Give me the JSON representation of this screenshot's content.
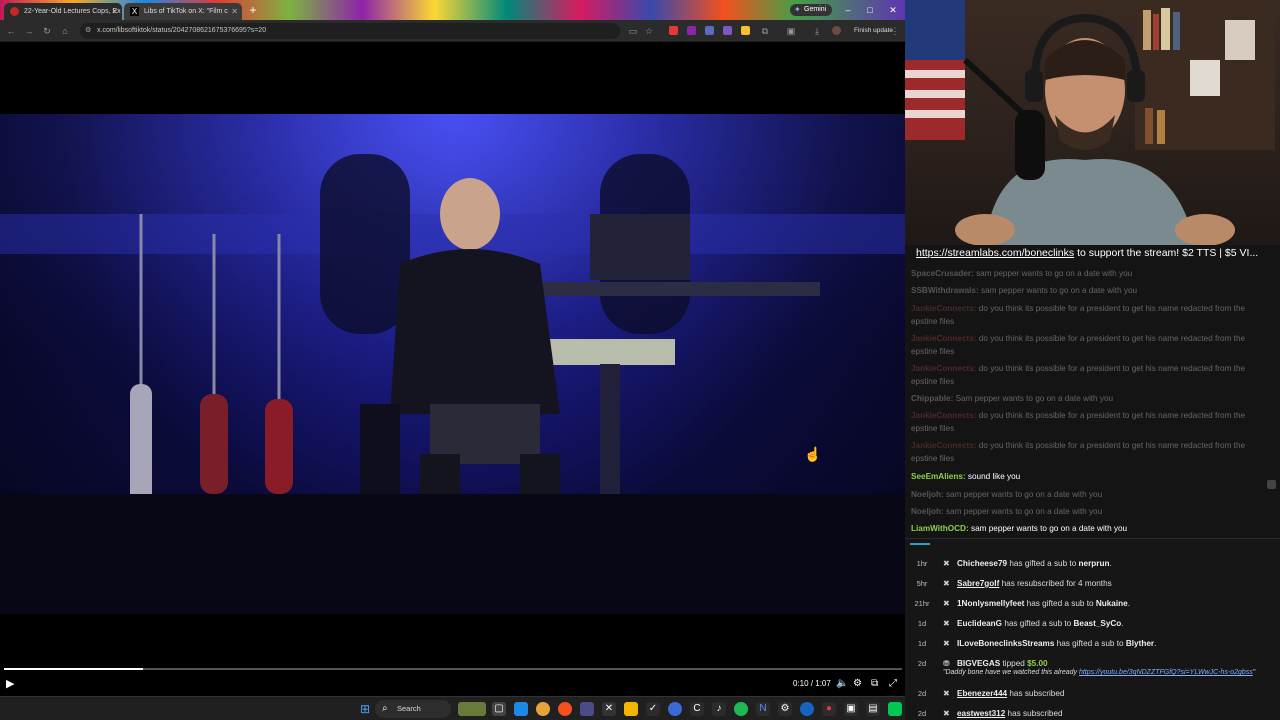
{
  "browser": {
    "tabs": [
      {
        "label": "22-Year-Old Lectures Cops, Ex",
        "active": false
      },
      {
        "label": "Libs of TikTok on X: \"Film c",
        "active": true
      }
    ],
    "new_tab": "+",
    "gemini_label": "Gemini",
    "url": "x.com/libsoftiktok/status/2042708621675376695?s=20",
    "finish_update": "Finish update",
    "window_controls": [
      "–",
      "□",
      "✕"
    ]
  },
  "video": {
    "progress": 0.155,
    "time_display": "0:10 / 1:07"
  },
  "chat": {
    "banner_link": "https://streamlabs.com/boneclinks",
    "banner_text": " to support the stream! $2 TTS | $5 VI...",
    "messages": [
      {
        "user": "SpaceCrusader:",
        "text": " sam pepper wants to go on a date with you",
        "bright": false,
        "color": "#555"
      },
      {
        "user": "SSBWithdrawals:",
        "text": " sam pepper wants to go on a date with you",
        "bright": false,
        "color": "#555"
      },
      {
        "user": "JankieConnects:",
        "text": " do you think its possible for a president to get his name redacted from the",
        "bright": false,
        "color": "#4a2a2a"
      },
      {
        "user": "",
        "text": "epstine files",
        "bright": false,
        "color": "#555"
      },
      {
        "user": "JankieConnects:",
        "text": " do you think its possible for a president to get his name redacted from the",
        "bright": false,
        "color": "#4a2a2a"
      },
      {
        "user": "",
        "text": "epstine files",
        "bright": false,
        "color": "#555"
      },
      {
        "user": "JankieConnects:",
        "text": " do you think its possible for a president to get his name redacted from the",
        "bright": false,
        "color": "#4a2a2a"
      },
      {
        "user": "",
        "text": "epstine files",
        "bright": false,
        "color": "#555"
      },
      {
        "user": "Chippable:",
        "text": " Sam pepper wants to go on a date with you",
        "bright": false,
        "color": "#555"
      },
      {
        "user": "JankieConnects:",
        "text": " do you think its possible for a president to get his name redacted from the",
        "bright": false,
        "color": "#4a2a2a"
      },
      {
        "user": "",
        "text": "epstine files",
        "bright": false,
        "color": "#555"
      },
      {
        "user": "JankieConnects:",
        "text": " do you think its possible for a president to get his name redacted from the",
        "bright": false,
        "color": "#4a2a2a"
      },
      {
        "user": "",
        "text": "epstine files",
        "bright": false,
        "color": "#555"
      },
      {
        "user": "SeeEmAliens:",
        "text": " sound like you",
        "bright": true,
        "color": "#8fd14f"
      },
      {
        "user": "Noeljoh:",
        "text": " sam pepper wants to go on a date with you",
        "bright": false,
        "color": "#555"
      },
      {
        "user": "Noeljoh:",
        "text": " sam pepper wants to go on a date with you",
        "bright": false,
        "color": "#555"
      },
      {
        "user": "LiamWithOCD:",
        "text": " sam pepper wants to go on a date with you",
        "bright": true,
        "color": "#8fd14f"
      }
    ]
  },
  "events": [
    {
      "age": "1hr",
      "user": "Chicheese79",
      "underline": false,
      "text": " has gifted a sub to ",
      "target": "nerprun",
      "tail": "."
    },
    {
      "age": "5hr",
      "user": "Sabre7golf",
      "underline": true,
      "text": " has resubscribed for 4 months",
      "target": "",
      "tail": ""
    },
    {
      "age": "21hr",
      "user": "1Nonlysmellyfeet",
      "underline": false,
      "text": " has gifted a sub to ",
      "target": "Nukaine",
      "tail": "."
    },
    {
      "age": "1d",
      "user": "EuclideanG",
      "underline": false,
      "text": " has gifted a sub to ",
      "target": "Beast_SyCo",
      "tail": "."
    },
    {
      "age": "1d",
      "user": "ILoveBoneclinksStreams",
      "underline": false,
      "text": " has gifted a sub to ",
      "target": "Blyther",
      "tail": "."
    },
    {
      "age": "2d",
      "user": "BIGVEGAS",
      "underline": false,
      "text": " tipped ",
      "target": "",
      "tail": "",
      "amount": "$5.00"
    },
    {
      "age": "2d",
      "user": "Ebenezer444",
      "underline": true,
      "text": " has subscribed",
      "target": "",
      "tail": ""
    },
    {
      "age": "2d",
      "user": "eastwest312",
      "underline": true,
      "text": " has subscribed",
      "target": "",
      "tail": ""
    }
  ],
  "tip_message": {
    "text": "\"Daddy bone have we watched this already ",
    "link": "https://youtu.be/3qNDZZTFGfQ?si=YLWwJC-hs-o2gbss",
    "close": "\""
  },
  "taskbar": {
    "search_label": "Search"
  },
  "colors": {
    "accent": "#2aa0c8",
    "tip_amount": "#8fd14f"
  }
}
